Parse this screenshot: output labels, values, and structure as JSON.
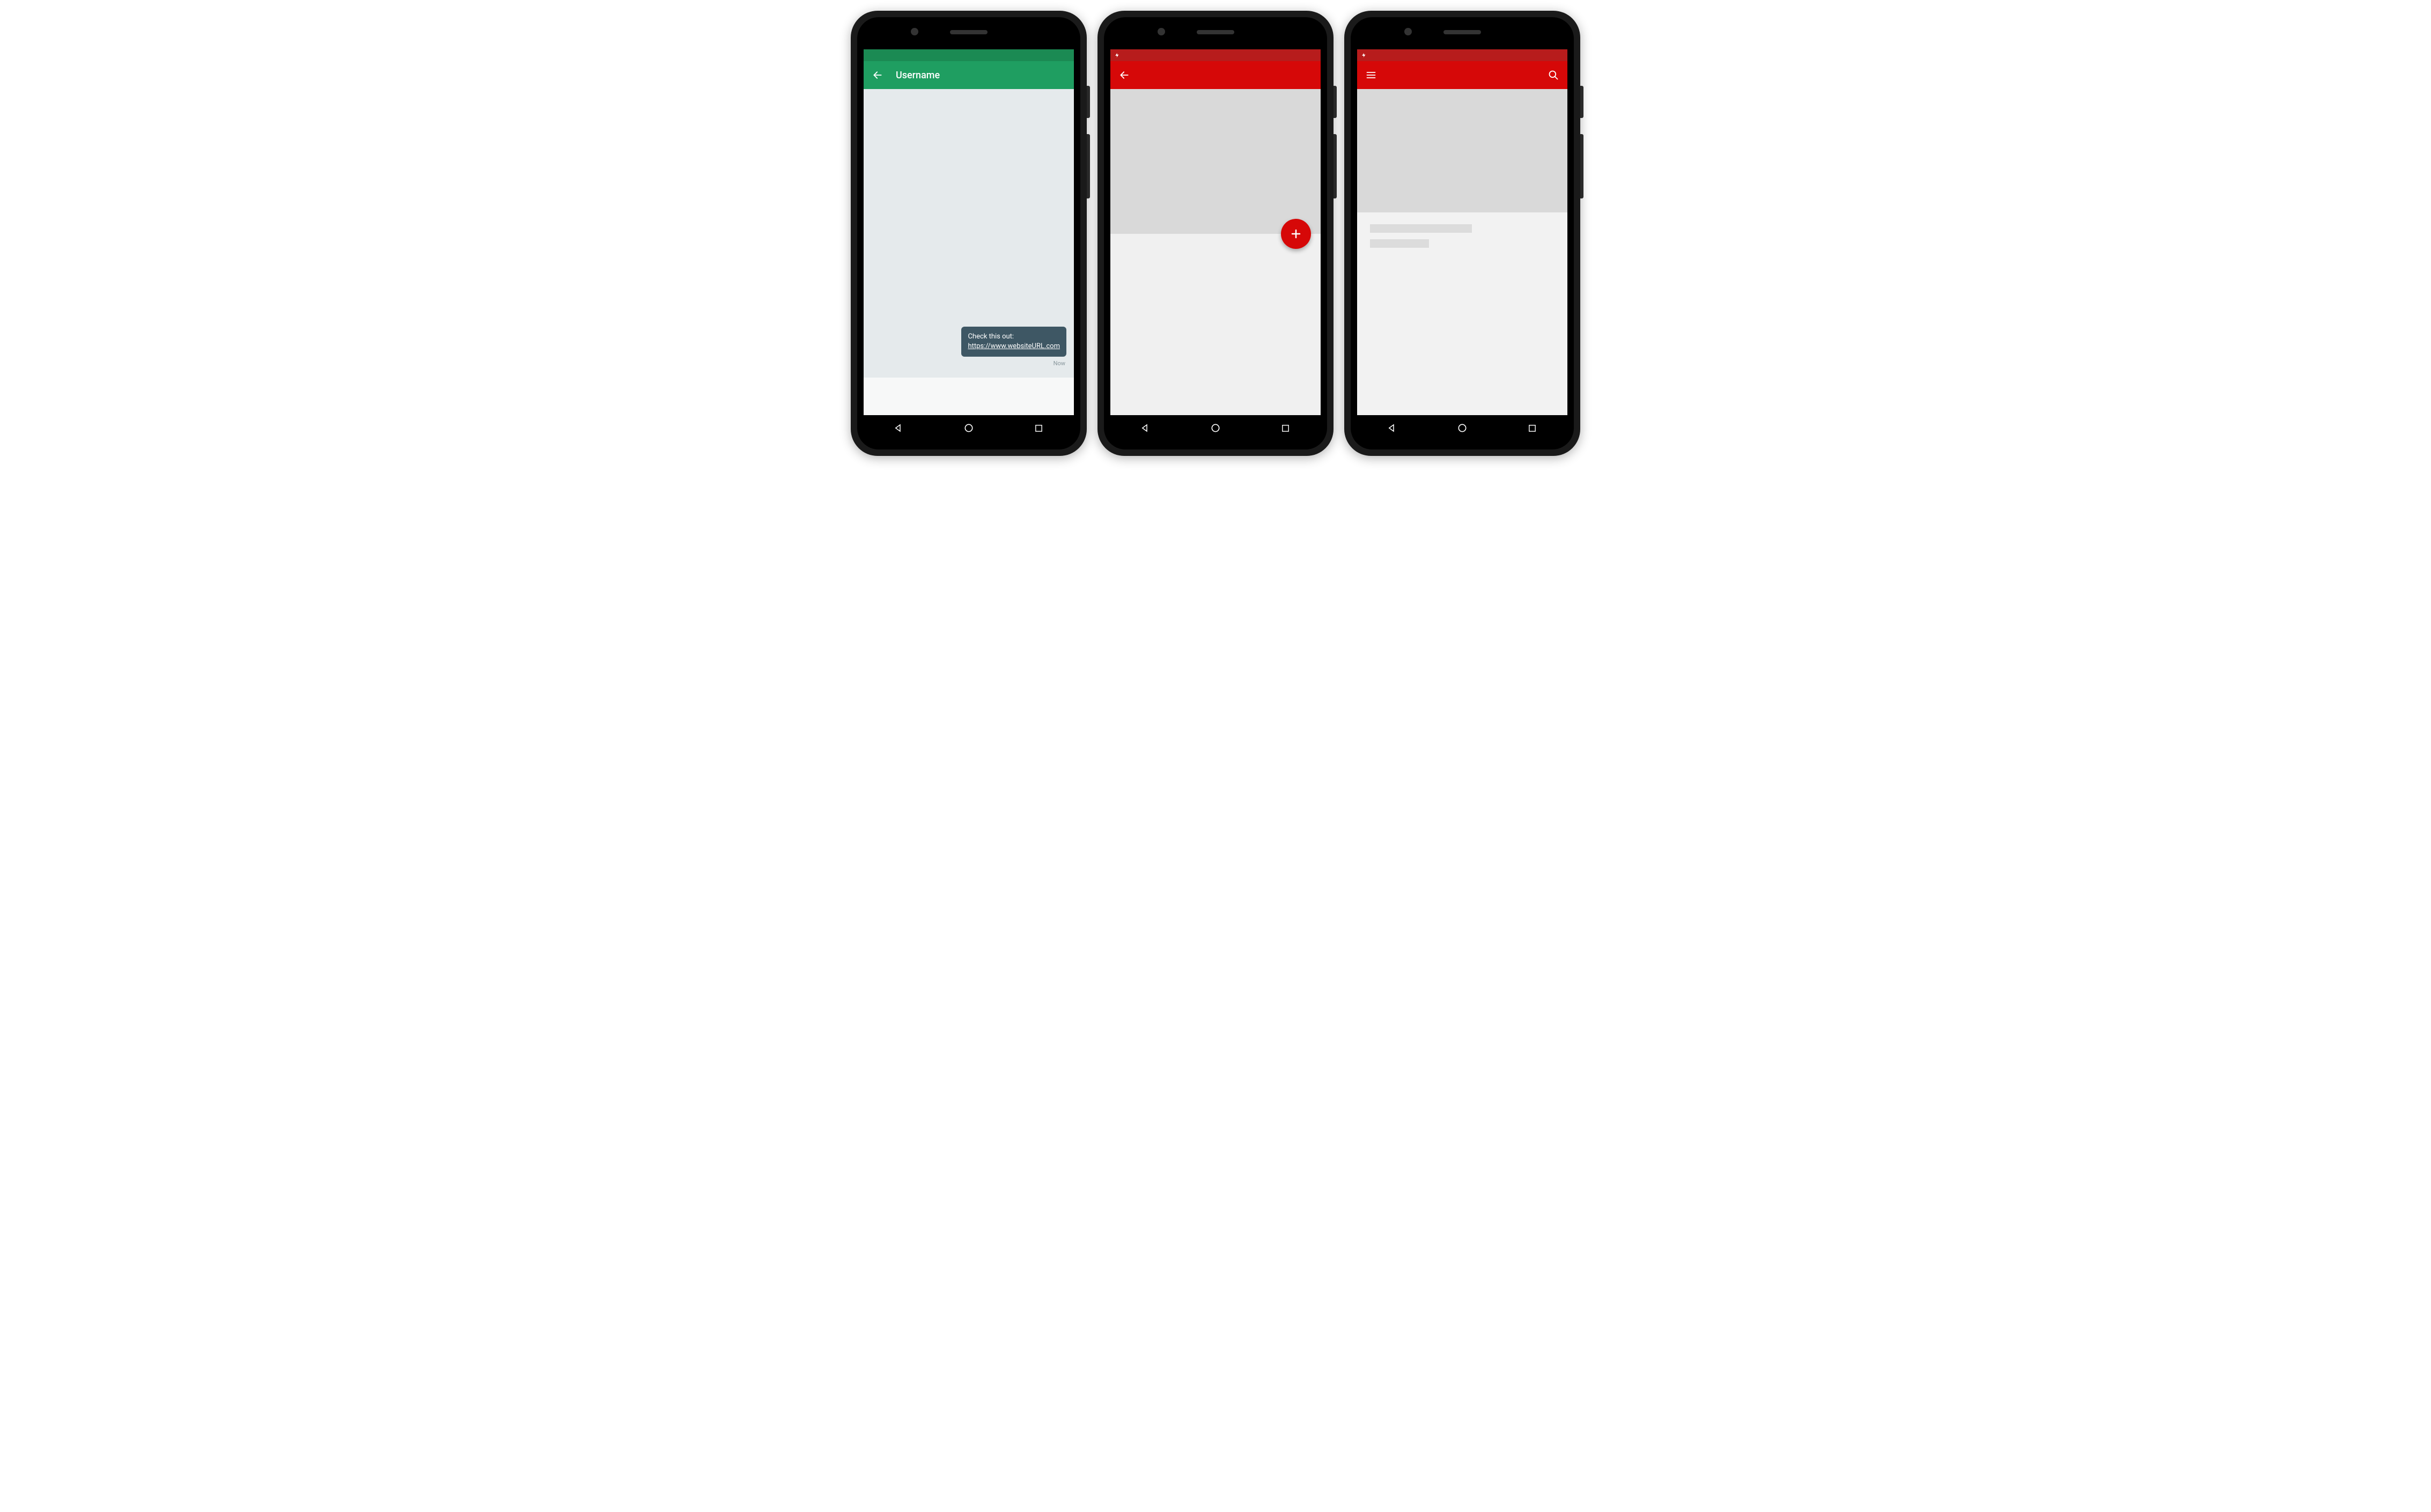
{
  "colors": {
    "green_status": "#1b8a53",
    "green_appbar": "#1f9e61",
    "red_status": "#b71c1c",
    "red_appbar": "#d60808",
    "bubble": "#3e5764"
  },
  "phone1": {
    "appbar_title": "Username",
    "message_text": "Check this out:",
    "message_link": "https://www.websiteURL.com",
    "timestamp": "Now"
  },
  "phone2": {},
  "phone3": {}
}
